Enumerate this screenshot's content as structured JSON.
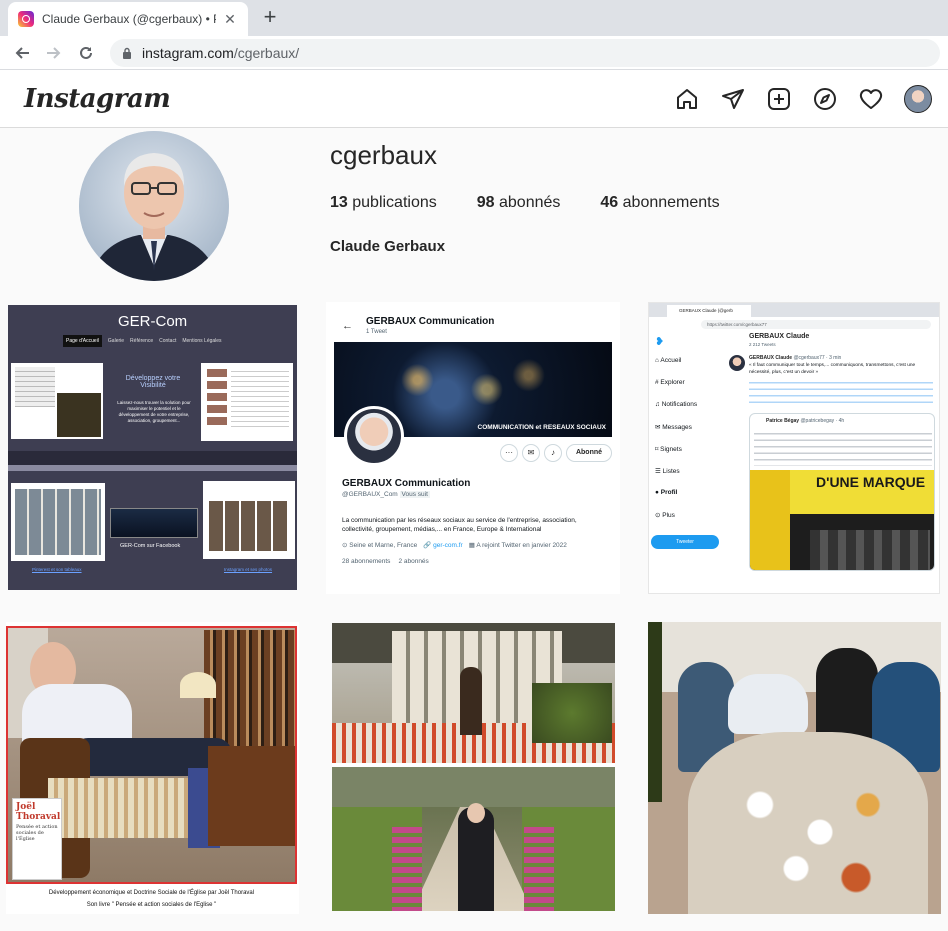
{
  "browser": {
    "tab_title": "Claude Gerbaux (@cgerbaux) • P",
    "url_domain": "instagram.com",
    "url_path": "/cgerbaux/"
  },
  "header": {
    "logo": "Instagram",
    "icons": [
      "home-icon",
      "direct-icon",
      "new-post-icon",
      "explore-icon",
      "activity-icon"
    ]
  },
  "profile": {
    "username": "cgerbaux",
    "posts_count": "13",
    "posts_label": "publications",
    "followers_count": "98",
    "followers_label": "abonnés",
    "following_count": "46",
    "following_label": "abonnements",
    "full_name": "Claude Gerbaux"
  },
  "posts": {
    "p1": {
      "brand": "GER-Com",
      "menu": [
        "Page d'Accueil",
        "Galerie",
        "Référence",
        "Contact",
        "Mentions Légales"
      ],
      "headline": "Développez votre Visibilité",
      "body": "Laissez-nous trouver la solution pour maximiser le potentiel et le développement de votre entreprise, association, groupement...",
      "fb_caption": "GER-Com sur Facebook",
      "link_left": "Pinterest et son tableaux",
      "link_right": "Instagram et ses photos"
    },
    "p2": {
      "name": "GERBAUX Communication",
      "tweets": "1 Tweet",
      "banner": "COMMUNICATION et RESEAUX SOCIAUX",
      "handle": "@GERBAUX_Com",
      "follows_you": "Vous suit",
      "follow_btn": "Abonné",
      "bio": "La communication par les réseaux sociaux au service de l'entreprise, association, collectivité, groupement, médias,... en France, Europe & International",
      "location": "Seine et Marne, France",
      "site": "ger-com.fr",
      "joined": "A rejoint Twitter en janvier 2022",
      "following": "28 abonnements",
      "followers": "2 abonnés"
    },
    "p3": {
      "tab": "GERBAUX Claude (@gerb",
      "url": "https://twitter.com/cgerbaux77",
      "profile_name": "GERBAUX Claude",
      "profile_tweets": "2 212 Tweets",
      "nav": [
        "Accueil",
        "Explorer",
        "Notifications",
        "Messages",
        "Signets",
        "Listes",
        "Profil",
        "Plus"
      ],
      "tweet_btn": "Tweeter",
      "tweet_author": "GERBAUX Claude",
      "tweet_handle": "@cgerbaux77 · 3 min",
      "tweet_text": "« Il faut communiquer tout le temps,... communiquons, transmettons, c'est une nécessité, plus, c'est un devoir »",
      "quoted_author": "Patrice Bégay",
      "quoted_handle": "@patricebegay · 4h",
      "banner_text": "D'UNE MARQUE"
    },
    "p4": {
      "book_author": "Joël Thoraval",
      "book_title": "Pensée et action sociales de l'Église",
      "caption1": "Développement économique et Doctrine Sociale de l'Église par Joël Thoraval",
      "caption2": "Son livre \" Pensée et action sociales de l'Eglise \""
    }
  },
  "colors": {
    "ig_text": "#262626",
    "ig_border": "#dbdbdb",
    "twitter_blue": "#1d9bf0",
    "gercom_bg": "#3e3e52"
  }
}
